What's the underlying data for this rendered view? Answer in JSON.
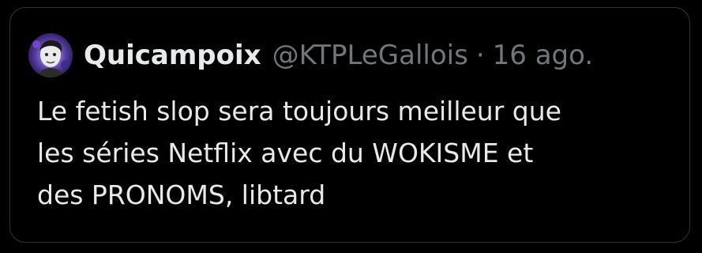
{
  "tweet": {
    "author": {
      "display_name": "Quicampoix",
      "handle": "@KTPLeGallois",
      "avatar": "avatar-image"
    },
    "separator": "·",
    "date": "16 ago.",
    "text_lines": [
      "Le fetish slop sera toujours meilleur que",
      "les séries Netflix avec du WOKISME et",
      "des PRONOMS, libtard"
    ]
  },
  "colors": {
    "background": "#000000",
    "border": "#2f3336",
    "primary_text": "#e7e9ea",
    "secondary_text": "#71767b"
  }
}
